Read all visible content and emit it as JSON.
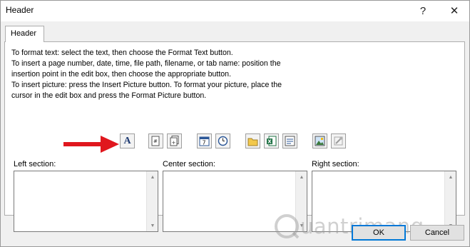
{
  "window": {
    "title": "Header",
    "help_glyph": "?",
    "close_glyph": "✕"
  },
  "tab": {
    "label": "Header"
  },
  "instructions": [
    "To format text:  select the text, then choose the Format Text button.",
    "To insert a page number, date, time, file path, filename, or tab name:  position the",
    "    insertion point in the edit box, then choose the appropriate button.",
    "To insert picture: press the Insert Picture button.  To format your picture, place the",
    "    cursor in the edit box and press the Format Picture button."
  ],
  "toolbar": [
    {
      "name": "format-text",
      "icon": "format-text-icon",
      "glyph": "A"
    },
    {
      "name": "insert-page-number",
      "icon": "page-number-icon"
    },
    {
      "name": "insert-number-of-pages",
      "icon": "number-of-pages-icon"
    },
    {
      "name": "insert-date",
      "icon": "calendar-icon",
      "glyph": "7"
    },
    {
      "name": "insert-time",
      "icon": "clock-icon"
    },
    {
      "name": "insert-file-path",
      "icon": "folder-icon"
    },
    {
      "name": "insert-filename",
      "icon": "excel-file-icon",
      "glyph": "X"
    },
    {
      "name": "insert-sheet-name",
      "icon": "sheet-tab-icon"
    },
    {
      "name": "insert-picture",
      "icon": "picture-icon"
    },
    {
      "name": "format-picture",
      "icon": "format-picture-icon"
    }
  ],
  "sections": {
    "left": {
      "label": "Left section:",
      "value": ""
    },
    "center": {
      "label": "Center section:",
      "value": ""
    },
    "right": {
      "label": "Right section:",
      "value": ""
    }
  },
  "buttons": {
    "ok": "OK",
    "cancel": "Cancel"
  },
  "watermark": {
    "text": "uantrimang"
  },
  "colors": {
    "arrow": "#e0171e",
    "ok_border": "#0078d7",
    "dialog_bg": "#f0f0f0"
  }
}
